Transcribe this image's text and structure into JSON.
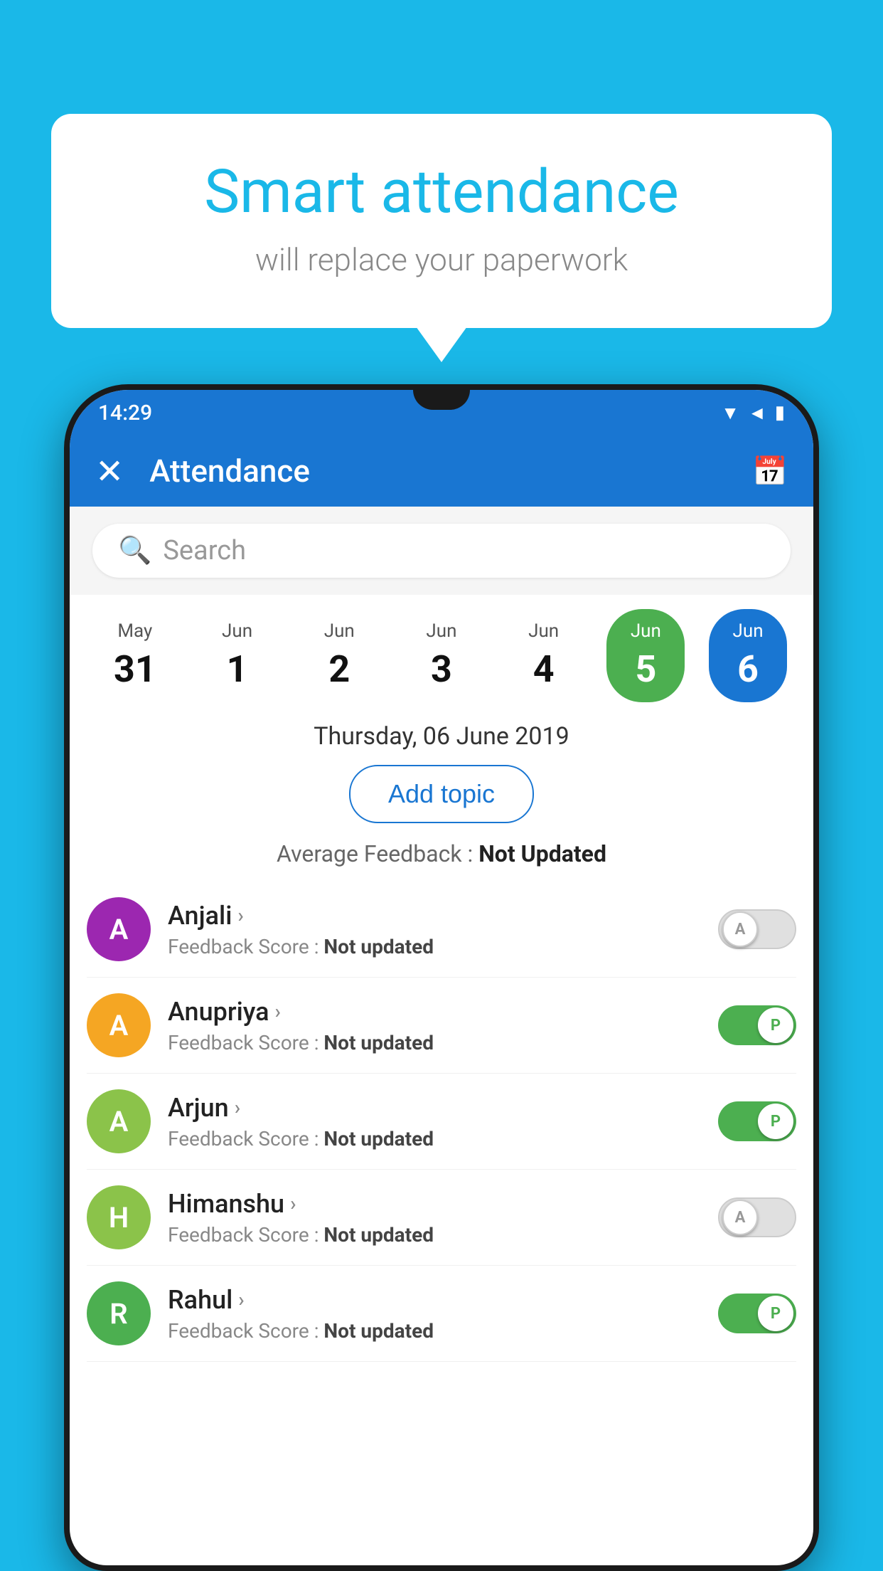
{
  "background_color": "#1ab8e8",
  "bubble": {
    "title": "Smart attendance",
    "subtitle": "will replace your paperwork"
  },
  "status_bar": {
    "time": "14:29",
    "icons": "▼◄▮"
  },
  "app_bar": {
    "title": "Attendance",
    "close_label": "✕",
    "calendar_label": "📅"
  },
  "search": {
    "placeholder": "Search"
  },
  "dates": [
    {
      "month": "May",
      "day": "31",
      "selected": ""
    },
    {
      "month": "Jun",
      "day": "1",
      "selected": ""
    },
    {
      "month": "Jun",
      "day": "2",
      "selected": ""
    },
    {
      "month": "Jun",
      "day": "3",
      "selected": ""
    },
    {
      "month": "Jun",
      "day": "4",
      "selected": ""
    },
    {
      "month": "Jun",
      "day": "5",
      "selected": "green"
    },
    {
      "month": "Jun",
      "day": "6",
      "selected": "blue"
    }
  ],
  "selected_date_label": "Thursday, 06 June 2019",
  "add_topic_label": "Add topic",
  "avg_feedback_prefix": "Average Feedback : ",
  "avg_feedback_value": "Not Updated",
  "students": [
    {
      "name": "Anjali",
      "initial": "A",
      "avatar_color": "#9c27b0",
      "feedback_prefix": "Feedback Score : ",
      "feedback_value": "Not updated",
      "toggle_state": "off",
      "toggle_label": "A"
    },
    {
      "name": "Anupriya",
      "initial": "A",
      "avatar_color": "#f5a623",
      "feedback_prefix": "Feedback Score : ",
      "feedback_value": "Not updated",
      "toggle_state": "on",
      "toggle_label": "P"
    },
    {
      "name": "Arjun",
      "initial": "A",
      "avatar_color": "#8bc34a",
      "feedback_prefix": "Feedback Score : ",
      "feedback_value": "Not updated",
      "toggle_state": "on",
      "toggle_label": "P"
    },
    {
      "name": "Himanshu",
      "initial": "H",
      "avatar_color": "#8bc34a",
      "feedback_prefix": "Feedback Score : ",
      "feedback_value": "Not updated",
      "toggle_state": "off",
      "toggle_label": "A"
    },
    {
      "name": "Rahul",
      "initial": "R",
      "avatar_color": "#4caf50",
      "feedback_prefix": "Feedback Score : ",
      "feedback_value": "Not updated",
      "toggle_state": "on",
      "toggle_label": "P"
    }
  ]
}
